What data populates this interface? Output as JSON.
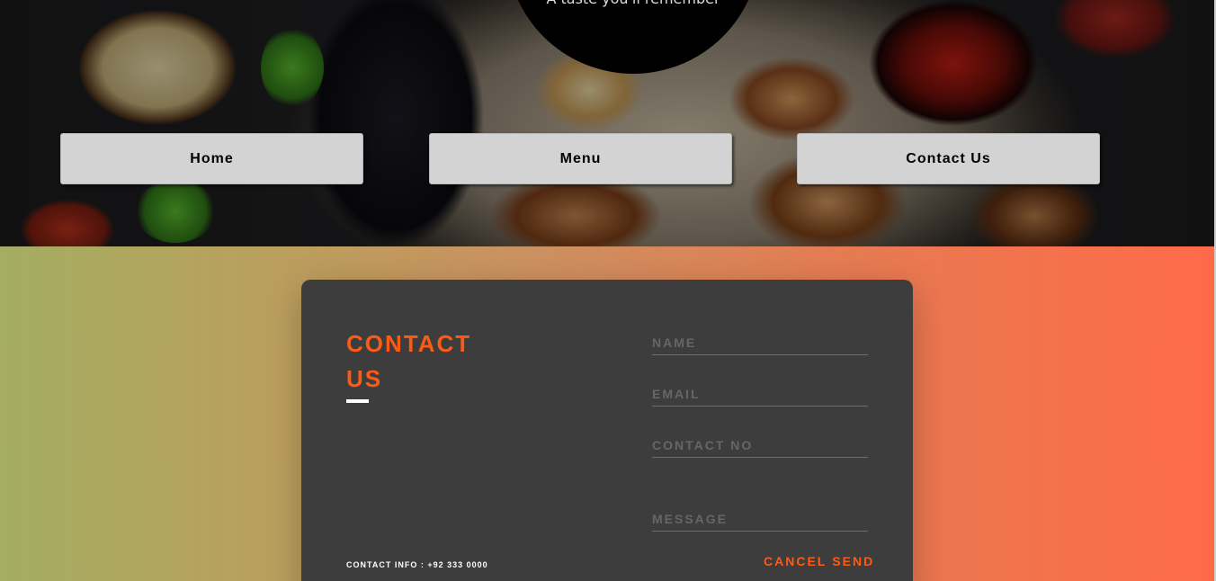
{
  "hero": {
    "tagline": "A taste you'll remember"
  },
  "nav": {
    "home": "Home",
    "menu": "Menu",
    "contact": "Contact Us"
  },
  "contact": {
    "title": "CONTACT US",
    "info": "CONTACT INFO : +92 333 0000",
    "fields": {
      "name": "NAME",
      "email": "EMAIL",
      "contact_no": "CONTACT NO",
      "message": "MESSAGE"
    },
    "cancel_label": "CANCEL",
    "send_label": "SEND"
  },
  "colors": {
    "accent": "#ff5a14",
    "card": "#3d3d3d",
    "gradient_left": "#a4ad62",
    "gradient_right": "#ff6a49"
  }
}
